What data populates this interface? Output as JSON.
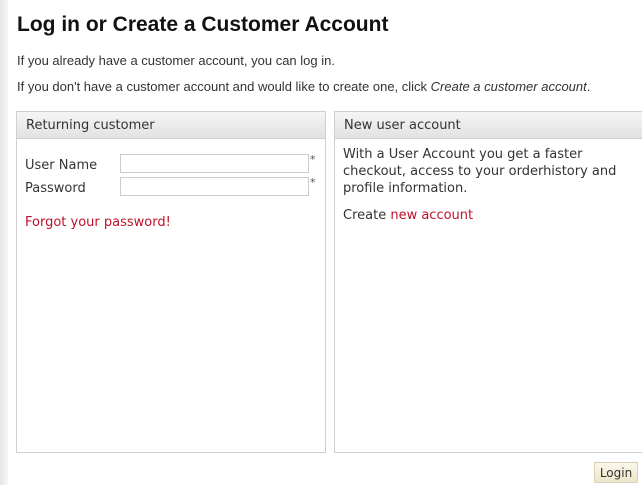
{
  "page": {
    "title": "Log in or Create a Customer Account",
    "intro_line1": "If you already have a customer account, you can log in.",
    "intro_line2_prefix": "If you don't have a customer account and would like to create one, click ",
    "intro_line2_link": "Create a customer account",
    "intro_line2_suffix": "."
  },
  "returning_customer": {
    "header": "Returning customer",
    "username_label": "User Name",
    "username_value": "",
    "password_label": "Password",
    "password_value": "",
    "required_mark": "*",
    "forgot_password": "Forgot your password!"
  },
  "new_user": {
    "header": "New user account",
    "description": "With a User Account you get a faster checkout, access to your orderhistory and profile information.",
    "create_prefix": "Create ",
    "create_link": "new account"
  },
  "actions": {
    "login_label": "Login"
  },
  "colors": {
    "link": "#c0102a",
    "panel_border": "#cfcfcf",
    "button_bg": "#f4efd9"
  }
}
